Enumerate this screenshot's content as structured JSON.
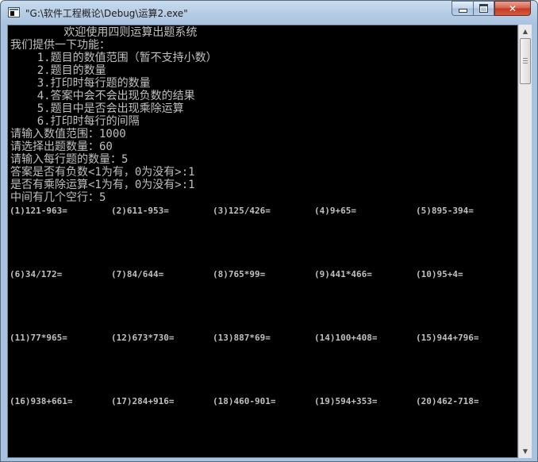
{
  "window": {
    "title": "\"G:\\软件工程概论\\Debug\\运算2.exe\"",
    "icon": "console-app-icon"
  },
  "controls": {
    "minimize": "minimize-icon",
    "maximize": "maximize-icon",
    "close_label": "✕"
  },
  "console": {
    "lines": [
      "        欢迎使用四则运算出题系统",
      "我们提供一下功能：",
      "    1.题目的数值范围（暂不支持小数）",
      "    2.题目的数量",
      "    3.打印时每行题的数量",
      "    4.答案中会不会出现负数的结果",
      "    5.题目中是否会出现乘除运算",
      "    6.打印时每行的间隔",
      "请输入数值范围：1000",
      "请选择出题数量：60",
      "请输入每行题的数量：5",
      "答案是否有负数<1为有，0为没有>:1",
      "是否有乘除运算<1为有，0为没有>:1",
      "中间有几个空行：5"
    ],
    "problem_rows": [
      [
        "(1)121-963=",
        "(2)611-953=",
        "(3)125/426=",
        "(4)9+65=",
        "(5)895-394="
      ],
      [
        "(6)34/172=",
        "(7)84/644=",
        "(8)765*99=",
        "(9)441*466=",
        "(10)95+4="
      ],
      [
        "(11)77*965=",
        "(12)673*730=",
        "(13)887*69=",
        "(14)100+408=",
        "(15)944+796="
      ],
      [
        "(16)938+661=",
        "(17)284+916=",
        "(18)460-901=",
        "(19)594+353=",
        "(20)462-718="
      ]
    ]
  },
  "scrollbar": {
    "up_arrow": "▲",
    "down_arrow": "▼"
  }
}
